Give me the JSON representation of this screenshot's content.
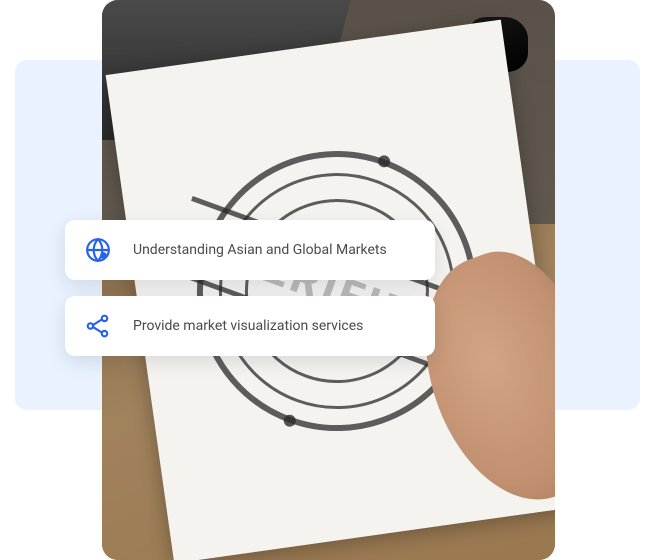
{
  "stamp": {
    "text": "VERIFIED"
  },
  "cards": [
    {
      "icon": "globe-icon",
      "label": "Understanding Asian and Global Markets"
    },
    {
      "icon": "network-icon",
      "label": "Provide market visualization services"
    }
  ],
  "colors": {
    "accent": "#2563eb",
    "panel": "#e9f2fe"
  }
}
